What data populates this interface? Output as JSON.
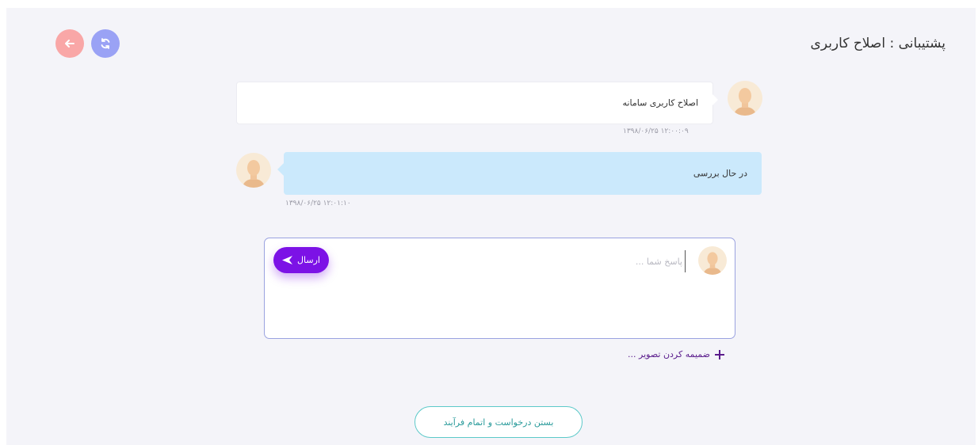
{
  "header": {
    "title": "پشتیبانی : اصلاح کاربری"
  },
  "toolbar": {
    "back_icon": "arrow-left-icon",
    "refresh_icon": "refresh-icon",
    "back_color": "#f9a7a7",
    "refresh_color": "#9aa2f5"
  },
  "messages": [
    {
      "text": "اصلاح کاربری سامانه",
      "timestamp": "۱۳۹۸/۰۶/۲۵   ۱۲:۰۰:۰۹"
    },
    {
      "text": "در حال بررسی",
      "timestamp": "۱۳۹۸/۰۶/۲۵   ۱۲:۰۱:۱۰"
    }
  ],
  "reply": {
    "placeholder": "پاسخ شما ...",
    "value": "",
    "send_label": "ارسال",
    "send_color": "#7c12e6"
  },
  "attach": {
    "label": "ضمیمه کردن تصویر ..."
  },
  "footer": {
    "close_label": "بستن درخواست و اتمام فرآیند",
    "close_color": "#5cc9c9"
  }
}
